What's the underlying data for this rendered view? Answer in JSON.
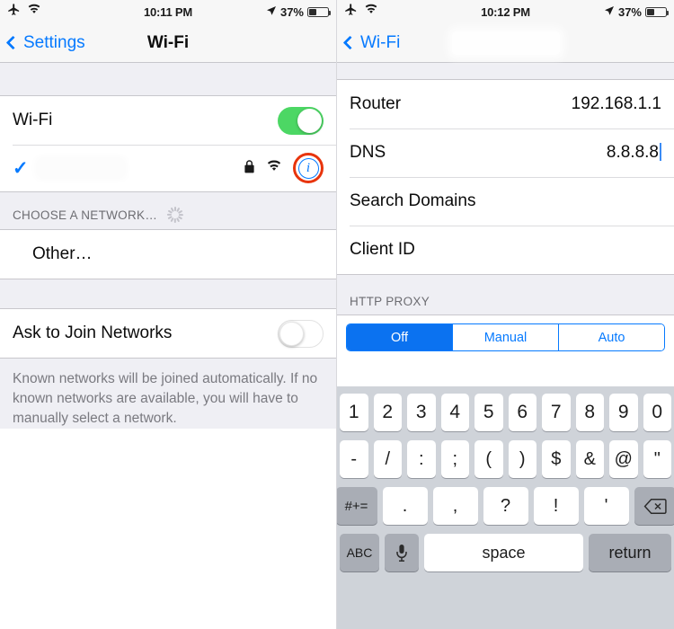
{
  "left": {
    "statusbar": {
      "airplane_icon": "airplane-icon",
      "wifi_icon": "wifi-icon",
      "time": "10:11 PM",
      "location_icon": "location-arrow-icon",
      "battery_percent": "37%"
    },
    "nav": {
      "back_label": "Settings",
      "title": "Wi-Fi"
    },
    "wifi_row": {
      "label": "Wi-Fi",
      "toggle_state": "on"
    },
    "connected_network": {
      "name": "",
      "checkmark": "✓",
      "lock_icon": "lock-icon",
      "signal_icon": "wifi-signal-icon",
      "info_icon": "info-icon"
    },
    "choose_network": {
      "header": "CHOOSE A NETWORK…",
      "spinner": "activity-spinner",
      "other_label": "Other…"
    },
    "ask_to_join": {
      "label": "Ask to Join Networks",
      "toggle_state": "off"
    },
    "footer": "Known networks will be joined automatically. If no known networks are available, you will have to manually select a network."
  },
  "right": {
    "statusbar": {
      "airplane_icon": "airplane-icon",
      "wifi_icon": "wifi-icon",
      "time": "10:12 PM",
      "location_icon": "location-arrow-icon",
      "battery_percent": "37%"
    },
    "nav": {
      "back_label": "Wi-Fi",
      "title": ""
    },
    "rows": [
      {
        "label": "Router",
        "value": "192.168.1.1",
        "editing": false
      },
      {
        "label": "DNS",
        "value": "8.8.8.8",
        "editing": true
      },
      {
        "label": "Search Domains",
        "value": "",
        "editing": false
      },
      {
        "label": "Client ID",
        "value": "",
        "editing": false
      }
    ],
    "http_proxy": {
      "header": "HTTP PROXY",
      "options": [
        "Off",
        "Manual",
        "Auto"
      ],
      "selected": "Off"
    },
    "keyboard": {
      "row1": [
        "1",
        "2",
        "3",
        "4",
        "5",
        "6",
        "7",
        "8",
        "9",
        "0"
      ],
      "row2": [
        "-",
        "/",
        ":",
        ";",
        "(",
        ")",
        "$",
        "&",
        "@",
        "\""
      ],
      "row3_shift": "#+=",
      "row3": [
        ".",
        ",",
        "?",
        "!",
        "'"
      ],
      "row3_backspace": "backspace-icon",
      "row4_abc": "ABC",
      "row4_mic": "microphone-icon",
      "row4_space": "space",
      "row4_return": "return"
    }
  },
  "colors": {
    "accent_blue": "#067aff",
    "toggle_green": "#4cd764",
    "highlight_red": "#e8340c",
    "segment_blue": "#0b72f0"
  }
}
